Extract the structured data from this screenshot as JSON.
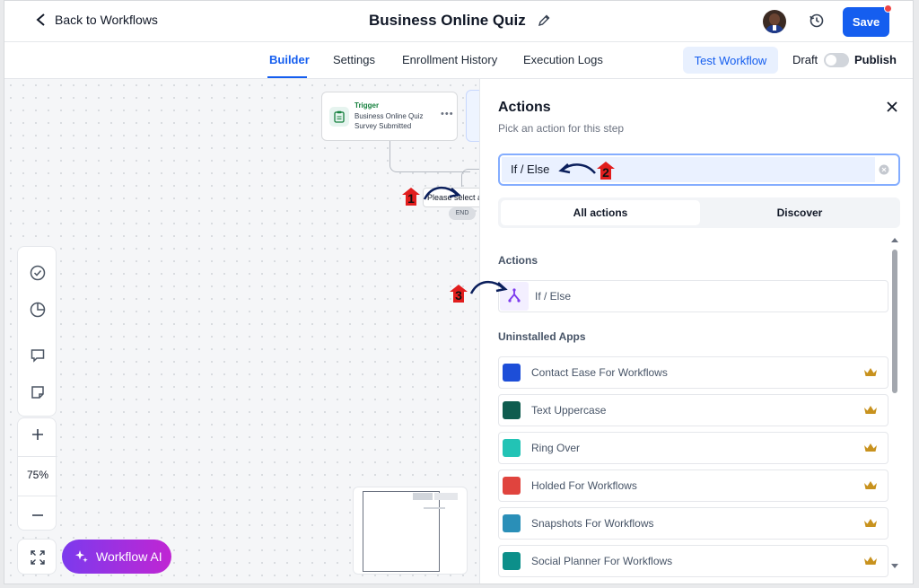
{
  "header": {
    "back_label": "Back to Workflows",
    "title": "Business Online Quiz",
    "save_label": "Save"
  },
  "tabs": [
    {
      "label": "Builder",
      "active": true
    },
    {
      "label": "Settings"
    },
    {
      "label": "Enrollment History"
    },
    {
      "label": "Execution Logs"
    }
  ],
  "toolbar": {
    "test_label": "Test Workflow",
    "draft_label": "Draft",
    "publish_label": "Publish",
    "publish_enabled": false
  },
  "canvas": {
    "trigger": {
      "label": "Trigger",
      "line1": "Business Online Quiz",
      "line2": "Survey Submitted"
    },
    "select_text": "Please select a",
    "end_label": "END",
    "zoom_level": "75%",
    "ai_label": "Workflow AI"
  },
  "panel": {
    "title": "Actions",
    "subtitle": "Pick an action for this step",
    "search_value": "If / Else",
    "seg_all": "All actions",
    "seg_discover": "Discover",
    "actions_title": "Actions",
    "action_item": "If / Else",
    "uninstalled_title": "Uninstalled Apps",
    "apps": [
      {
        "label": "Contact Ease For Workflows",
        "color": "#1d4ed8"
      },
      {
        "label": "Text Uppercase",
        "color": "#0f5c4f"
      },
      {
        "label": "Ring Over",
        "color": "#22c3b5"
      },
      {
        "label": "Holded For Workflows",
        "color": "#e0443e"
      },
      {
        "label": "Snapshots For Workflows",
        "color": "#2a8fb8"
      },
      {
        "label": "Social Planner For Workflows",
        "color": "#0c8f8a"
      }
    ]
  },
  "annotations": [
    "1",
    "2",
    "3"
  ],
  "colors": {
    "accent": "#155eef",
    "ai_gradient_start": "#7c3aed",
    "ai_gradient_end": "#c026d3",
    "crown": "#c8921e",
    "annotation_red": "#e11d1d"
  }
}
